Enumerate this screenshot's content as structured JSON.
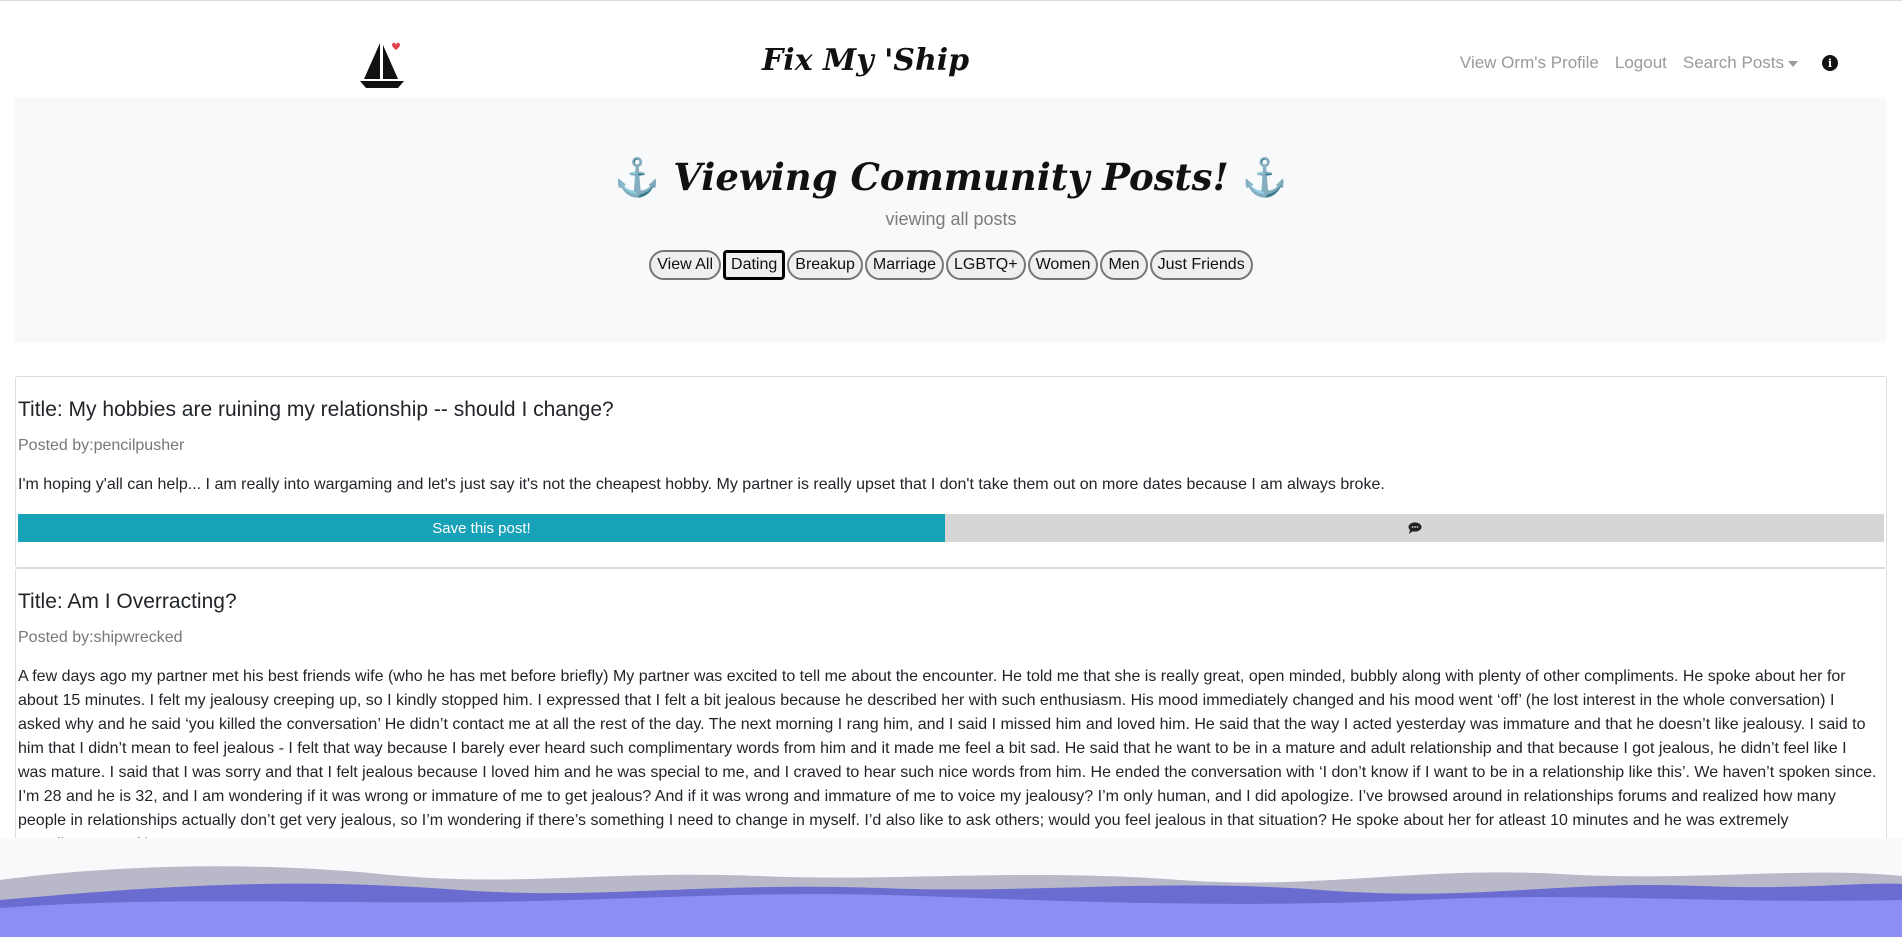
{
  "navbar": {
    "brand": "Fix My 'Ship",
    "links": {
      "profile": "View Orm's Profile",
      "logout": "Logout",
      "search": "Search Posts"
    },
    "icons": [
      "sailboat-logo",
      "heart-icon",
      "info-icon"
    ]
  },
  "hero": {
    "title": "Viewing Community Posts!",
    "subtitle": "viewing all posts",
    "filters": [
      "View All",
      "Dating",
      "Breakup",
      "Marriage",
      "LGBTQ+",
      "Women",
      "Men",
      "Just Friends"
    ],
    "active_filter": "Dating"
  },
  "posts": [
    {
      "title": "Title: My hobbies are ruining my relationship -- should I change?",
      "author": "Posted by:pencilpusher",
      "body": "I'm hoping y'all can help... I am really into wargaming and let's just say it's not the cheapest hobby. My partner is really upset that I don't take them out on more dates because I am always broke.",
      "save_label": "Save this post!",
      "comment_icon": "comment-icon"
    },
    {
      "title": "Title: Am I Overracting?",
      "author": "Posted by:shipwrecked",
      "body": "A few days ago my partner met his best friends wife (who he has met before briefly) My partner was excited to tell me about the encounter. He told me that she is really great, open minded, bubbly along with plenty of other compliments. He spoke about her for about 15 minutes. I felt my jealousy creeping up, so I kindly stopped him. I expressed that I felt a bit jealous because he described her with such enthusiasm. His mood immediately changed and his mood went ‘off’ (he lost interest in the whole conversation) I asked why and he said ‘you killed the conversation’ He didn’t contact me at all the rest of the day. The next morning I rang him, and I said I missed him and loved him. He said that the way I acted yesterday was immature and that he doesn’t like jealousy. I said to him that I didn’t mean to feel jealous - I felt that way because I barely ever heard such complimentary words from him and it made me feel a bit sad. He said that he want to be in a mature and adult relationship and that because I got jealous, he didn’t feel like I was mature. I said that I was sorry and that I felt jealous because I loved him and he was special to me, and I craved to hear such nice words from him. He ended the conversation with ‘I don’t know if I want to be in a relationship like this’. We haven’t spoken since. I’m 28 and he is 32, and I am wondering if it was wrong or immature of me to get jealous? And if it was wrong and immature of me to voice my jealousy? I’m only human, and I did apologize. I’ve browsed around in relationships forums and realized how many people in relationships actually don’t get very jealous, so I’m wondering if there’s something I need to change in myself. I’d also like to ask others; would you feel jealous in that situation? He spoke about her for atleast 10 minutes and he was extremely complimentary of her."
    }
  ],
  "colors": {
    "accent": "#17a2b8",
    "hero_bg": "#f8f9fa",
    "wave_light": "#8c8ef5",
    "wave_dark": "#6a6cd0",
    "wave_gray": "#b8b8c8",
    "heart": "#e0474c"
  }
}
